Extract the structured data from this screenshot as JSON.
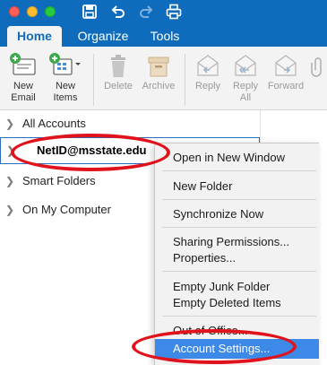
{
  "titlebar": {
    "icons": [
      "save-icon",
      "undo-icon",
      "redo-icon",
      "print-icon"
    ]
  },
  "tabs": [
    {
      "label": "Home",
      "active": true
    },
    {
      "label": "Organize",
      "active": false
    },
    {
      "label": "Tools",
      "active": false
    }
  ],
  "ribbon": {
    "new_email": "New\nEmail",
    "new_email_1": "New",
    "new_email_2": "Email",
    "new_items_1": "New",
    "new_items_2": "Items",
    "delete": "Delete",
    "archive": "Archive",
    "reply": "Reply",
    "reply_all_1": "Reply",
    "reply_all_2": "All",
    "forward": "Forward"
  },
  "folders": {
    "items": [
      {
        "label": "All Accounts"
      },
      {
        "label": "NetID@msstate.edu"
      },
      {
        "label": "Smart Folders"
      },
      {
        "label": "On My Computer"
      }
    ]
  },
  "context_menu": {
    "open_new_window": "Open in New Window",
    "new_folder": "New Folder",
    "synchronize_now": "Synchronize Now",
    "sharing_permissions": "Sharing Permissions...",
    "properties": "Properties...",
    "empty_junk": "Empty Junk Folder",
    "empty_deleted": "Empty Deleted Items",
    "out_of_office": "Out of Office...",
    "account_settings": "Account Settings..."
  },
  "colors": {
    "accent": "#0f6cbd",
    "highlight": "#3d89e8",
    "annotation": "#e0131d"
  }
}
